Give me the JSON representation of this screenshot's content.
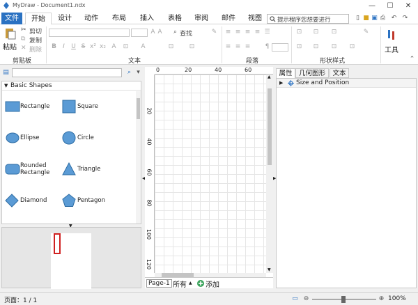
{
  "window": {
    "title": "MyDraw - Document1.ndx",
    "controls": [
      "—",
      "☐",
      "✕"
    ]
  },
  "menu": {
    "tabs": [
      "文件",
      "开始",
      "设计",
      "动作",
      "布局",
      "插入",
      "表格",
      "审阅",
      "邮件",
      "视图"
    ],
    "search_placeholder": "提示程序您想要进行"
  },
  "ribbon": {
    "clipboard": {
      "paste": "粘贴",
      "cut": "剪切",
      "copy": "复制",
      "delete": "删除",
      "label": "剪贴板"
    },
    "text": {
      "find": "查找",
      "label": "文本",
      "format_buttons": [
        "B",
        "I",
        "U",
        "S",
        "x²",
        "x₂"
      ]
    },
    "paragraph": {
      "label": "段落"
    },
    "shape_style": {
      "label": "形状样式"
    },
    "tools": {
      "label": "工具"
    }
  },
  "shapes": {
    "category": "Basic Shapes",
    "items": [
      {
        "label": "Rectangle",
        "icon": "rectangle-icon"
      },
      {
        "label": "Square",
        "icon": "square-icon"
      },
      {
        "label": "Ellipse",
        "icon": "ellipse-icon"
      },
      {
        "label": "Circle",
        "icon": "circle-icon"
      },
      {
        "label": "Rounded Rectangle",
        "icon": "rounded-rectangle-icon"
      },
      {
        "label": "Triangle",
        "icon": "triangle-icon"
      },
      {
        "label": "Diamond",
        "icon": "diamond-icon"
      },
      {
        "label": "Pentagon",
        "icon": "pentagon-icon"
      }
    ],
    "shape_color": "#5b9bd5",
    "shape_border": "#2e6da4"
  },
  "canvas": {
    "ruler_top": [
      "0",
      "20",
      "40",
      "60"
    ],
    "ruler_left": [
      "20",
      "40",
      "60",
      "80",
      "100",
      "120"
    ],
    "page_tab": "Page-1",
    "all_label": "所有",
    "add_label": "添加"
  },
  "properties": {
    "tabs": [
      "属性",
      "几何图形",
      "文本"
    ],
    "section": "Size and Position"
  },
  "status": {
    "page": "页面：1 / 1",
    "zoom": "100%"
  },
  "colors": {
    "accent": "#2b72c2"
  }
}
